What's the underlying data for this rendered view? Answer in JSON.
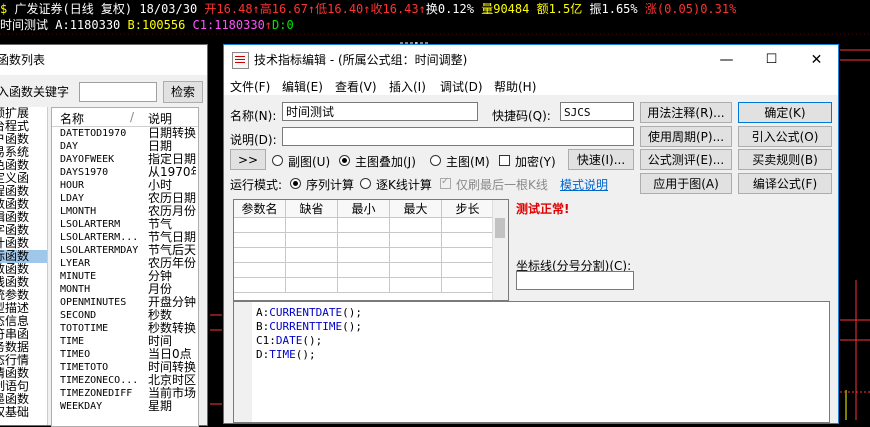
{
  "quote_bar": {
    "name": "广发证券(日线 复权)",
    "date": "18/03/30",
    "open": "开16.48",
    "high": "高16.67",
    "low": "低16.40",
    "close": "收16.43",
    "turnover": "换0.12%",
    "volume": "量90484",
    "amount": "额1.5亿",
    "amplitude": "振1.65%",
    "change": "涨(0.05)0.31%",
    "arrow": "↑"
  },
  "indicator_bar": {
    "name": "时间测试",
    "a": "A:1180330",
    "b": "B:100556",
    "c1": "C1:1180330",
    "d": "D:0",
    "arrow": "↑"
  },
  "colors": {
    "chart_bg": "#000000",
    "red": "#ff3232",
    "yellow": "#ffff00",
    "green": "#00e600",
    "cyan": "#00ffff",
    "keyword": "#0000c8"
  },
  "func_window": {
    "title": "函数列表",
    "search_label": "入函数关键字",
    "search_value": "",
    "search_button": "检索",
    "categories": [
      "频扩展",
      "台程式",
      "户函数",
      "易系统",
      "色函数",
      "定义函",
      "程函数",
      "数函数",
      "辑函数",
      "字函数",
      "计函数",
      "标函数",
      "数函数",
      "线函数",
      "统参数",
      "型描述",
      "态信息",
      "符串函",
      "务数据",
      "态行情",
      "情函数",
      "制语句",
      "墨函数",
      "权基础"
    ],
    "selected_category_index": 11,
    "col_name": "名称",
    "col_sep": "/",
    "col_desc": "说明",
    "functions": [
      {
        "name": "DATETOD1970",
        "desc": "日期转换"
      },
      {
        "name": "DAY",
        "desc": "日期"
      },
      {
        "name": "DAYOFWEEK",
        "desc": "指定日期"
      },
      {
        "name": "DAYS1970",
        "desc": "从1970年"
      },
      {
        "name": "HOUR",
        "desc": "小时"
      },
      {
        "name": "LDAY",
        "desc": "农历日期"
      },
      {
        "name": "LMONTH",
        "desc": "农历月份"
      },
      {
        "name": "LSOLARTERM",
        "desc": "节气"
      },
      {
        "name": "LSOLARTERM...",
        "desc": "节气日期"
      },
      {
        "name": "LSOLARTERMDAY",
        "desc": "节气后天"
      },
      {
        "name": "LYEAR",
        "desc": "农历年份"
      },
      {
        "name": "MINUTE",
        "desc": "分钟"
      },
      {
        "name": "MONTH",
        "desc": "月份"
      },
      {
        "name": "OPENMINUTES",
        "desc": "开盘分钟"
      },
      {
        "name": "SECOND",
        "desc": "秒数"
      },
      {
        "name": "TOTOTIME",
        "desc": "秒数转换"
      },
      {
        "name": "TIME",
        "desc": "时间"
      },
      {
        "name": "TIMEO",
        "desc": "当日0点"
      },
      {
        "name": "TIMETOTO",
        "desc": "时间转换"
      },
      {
        "name": "TIMEZONECO...",
        "desc": "北京时区"
      },
      {
        "name": "TIMEZONEDIFF",
        "desc": "当前市场"
      },
      {
        "name": "WEEKDAY",
        "desc": "星期"
      }
    ]
  },
  "dialog": {
    "title": "技术指标编辑 - (所属公式组：时间调整)",
    "window_buttons": {
      "min": "—",
      "max": "☐",
      "close": "✕"
    },
    "menu": [
      "文件(F)",
      "编辑(E)",
      "查看(V)",
      "插入(I)",
      "调试(D)",
      "帮助(H)"
    ],
    "name_label": "名称(N):",
    "name_value": "时间测试",
    "shortcut_label": "快捷码(Q):",
    "shortcut_value": "SJCS",
    "desc_label": "说明(D):",
    "desc_value": "",
    "expand_button": ">>",
    "radio_sub": "副图(U)",
    "radio_main_overlay": "主图叠加(J)",
    "radio_main": "主图(M)",
    "check_encrypt": "加密(Y)",
    "quick_button": "快速(I)...",
    "run_mode_label": "运行模式:",
    "radio_sequence": "序列计算",
    "radio_tick": "逐K线计算",
    "check_last_only": "仅刷最后一根K线",
    "mode_link": "模式说明",
    "param_headers": [
      "参数名",
      "缺省",
      "最小",
      "最大",
      "步长"
    ],
    "test_status": "测试正常!",
    "axis_label": "坐标线(分号分割)(C):",
    "axis_value": "",
    "right_buttons": [
      [
        "用法注释(R)...",
        "确定(K)"
      ],
      [
        "使用周期(P)...",
        "引入公式(O)"
      ],
      [
        "公式测评(E)...",
        "买卖规则(B)"
      ],
      [
        "应用于图(A)",
        "编译公式(F)"
      ]
    ],
    "code_lines": [
      {
        "lhs": "A:",
        "fn": "CURRENTDATE",
        "rest": "();"
      },
      {
        "lhs": "B:",
        "fn": "CURRENTTIME",
        "rest": "();"
      },
      {
        "lhs": "C1:",
        "fn": "DATE",
        "rest": "();"
      },
      {
        "lhs": "D:",
        "fn": "TIME",
        "rest": "();"
      }
    ]
  }
}
